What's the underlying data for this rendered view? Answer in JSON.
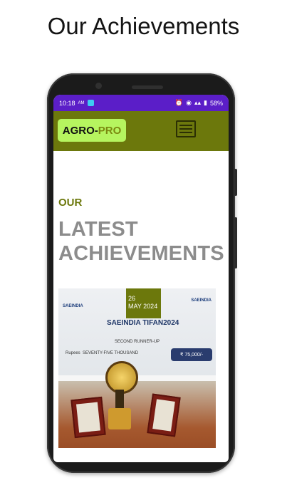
{
  "heading": "Our Achievements",
  "status_bar": {
    "time": "10:18",
    "ampm": "AM",
    "battery": "58%"
  },
  "header": {
    "logo_part1": "AGRO",
    "logo_part2": "-",
    "logo_part3": "PRO",
    "menu_icon": "hamburger-menu-icon"
  },
  "section": {
    "eyebrow": "OUR",
    "title_line1": "LATEST",
    "title_line2": "ACHIEVEMENTS"
  },
  "achievement": {
    "date_day": "26",
    "date_month_year": "MAY 2024",
    "banner_left": "SAEINDIA",
    "banner_right": "SAEINDIA",
    "banner_title": "SAEINDIA TIFAN2024",
    "runner_up": "SECOND RUNNER-UP",
    "rupees_label": "Rupees",
    "rupees_words": "SEVENTY-FIVE THOUSAND",
    "amount": "₹ 75,000/-"
  },
  "colors": {
    "status_bar": "#5b1ec8",
    "brand_olive": "#6c780c",
    "logo_bg": "#b6f55f",
    "title_gray": "#8c8c8c"
  }
}
